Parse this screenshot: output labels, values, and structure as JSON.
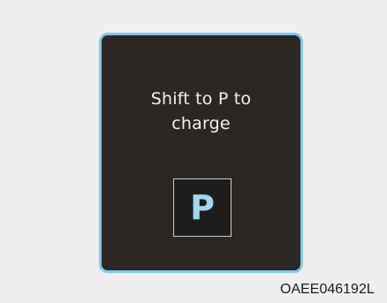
{
  "display": {
    "message_line1": "Shift to P to",
    "message_line2": "charge",
    "gear_indicator": "P"
  },
  "figure_code": "OAEE046192L",
  "colors": {
    "panel_background": "#2a2725",
    "panel_border": "#7ec8ec",
    "gear_letter": "#9fd8f1",
    "page_background": "#efefef"
  }
}
